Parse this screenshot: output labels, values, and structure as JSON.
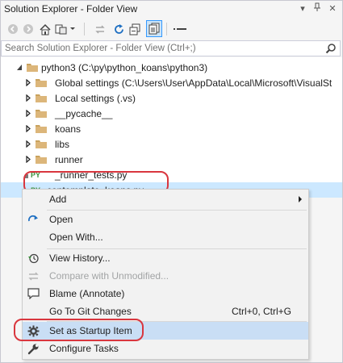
{
  "window": {
    "title": "Solution Explorer - Folder View"
  },
  "search": {
    "placeholder": "Search Solution Explorer - Folder View (Ctrl+;)"
  },
  "tree": {
    "root": "python3 (C:\\py\\python_koans\\python3)",
    "items": [
      {
        "label": "Global settings (C:\\Users\\User\\AppData\\Local\\Microsoft\\VisualSt",
        "icon": "folder-icon"
      },
      {
        "label": "Local settings (.vs)",
        "icon": "folder-icon"
      },
      {
        "label": "__pycache__",
        "icon": "folder-icon"
      },
      {
        "label": "koans",
        "icon": "folder-icon"
      },
      {
        "label": "libs",
        "icon": "folder-icon"
      },
      {
        "label": "runner",
        "icon": "folder-icon"
      },
      {
        "label": "_runner_tests.py",
        "icon": "python-file-icon"
      },
      {
        "label": "contemplate_koans.py",
        "icon": "python-file-icon",
        "selected": true
      }
    ]
  },
  "context_menu": {
    "add": "Add",
    "open": "Open",
    "open_with": "Open With...",
    "view_history": "View History...",
    "compare_unmodified": "Compare with Unmodified...",
    "blame": "Blame (Annotate)",
    "goto_git_changes": "Go To Git Changes",
    "goto_git_changes_shortcut": "Ctrl+0, Ctrl+G",
    "set_startup": "Set as Startup Item",
    "configure_tasks": "Configure Tasks"
  },
  "colors": {
    "selection": "#cce8ff",
    "menu_hover": "#c9def5",
    "highlight_oval": "#d9363e",
    "folder": "#dcb67a"
  }
}
